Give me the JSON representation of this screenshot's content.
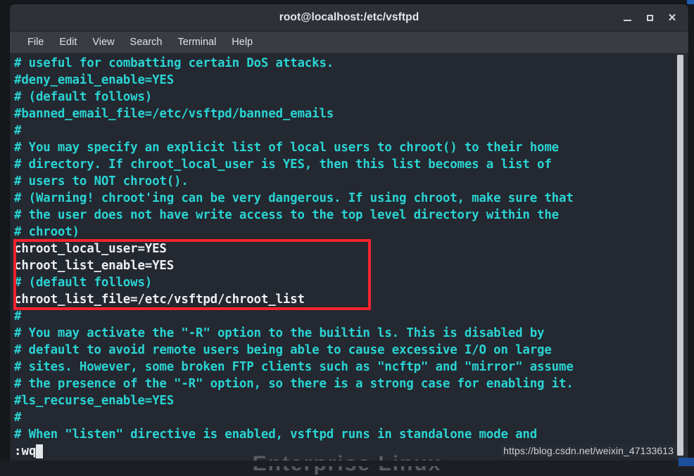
{
  "window": {
    "title": "root@localhost:/etc/vsftpd",
    "controls": [
      {
        "name": "minimize",
        "label": "_"
      },
      {
        "name": "maximize",
        "label": "□"
      },
      {
        "name": "close",
        "label": "✕"
      }
    ]
  },
  "menu": {
    "items": [
      "File",
      "Edit",
      "View",
      "Search",
      "Terminal",
      "Help"
    ]
  },
  "terminal": {
    "lines": [
      {
        "text": "# useful for combatting certain DoS attacks.",
        "kind": "comment"
      },
      {
        "text": "#deny_email_enable=YES",
        "kind": "comment"
      },
      {
        "text": "# (default follows)",
        "kind": "comment"
      },
      {
        "text": "#banned_email_file=/etc/vsftpd/banned_emails",
        "kind": "comment"
      },
      {
        "text": "#",
        "kind": "comment"
      },
      {
        "text": "# You may specify an explicit list of local users to chroot() to their home",
        "kind": "comment"
      },
      {
        "text": "# directory. If chroot_local_user is YES, then this list becomes a list of",
        "kind": "comment"
      },
      {
        "text": "# users to NOT chroot().",
        "kind": "comment"
      },
      {
        "text": "# (Warning! chroot'ing can be very dangerous. If using chroot, make sure that",
        "kind": "comment"
      },
      {
        "text": "# the user does not have write access to the top level directory within the",
        "kind": "comment"
      },
      {
        "text": "# chroot)",
        "kind": "comment"
      },
      {
        "text": "chroot_local_user=YES",
        "kind": "config"
      },
      {
        "text": "chroot_list_enable=YES",
        "kind": "config"
      },
      {
        "text": "# (default follows)",
        "kind": "comment"
      },
      {
        "text": "chroot_list_file=/etc/vsftpd/chroot_list",
        "kind": "config"
      },
      {
        "text": "#",
        "kind": "comment"
      },
      {
        "text": "# You may activate the \"-R\" option to the builtin ls. This is disabled by",
        "kind": "comment"
      },
      {
        "text": "# default to avoid remote users being able to cause excessive I/O on large",
        "kind": "comment"
      },
      {
        "text": "# sites. However, some broken FTP clients such as \"ncftp\" and \"mirror\" assume",
        "kind": "comment"
      },
      {
        "text": "# the presence of the \"-R\" option, so there is a strong case for enabling it.",
        "kind": "comment"
      },
      {
        "text": "#ls_recurse_enable=YES",
        "kind": "comment"
      },
      {
        "text": "#",
        "kind": "comment"
      },
      {
        "text": "# When \"listen\" directive is enabled, vsftpd runs in standalone mode and",
        "kind": "comment"
      }
    ],
    "status_command": ":wq",
    "highlight_color": "#f5232f",
    "comment_color": "#2ad4d4",
    "config_color": "#eceff2",
    "background_color": "#242830"
  },
  "watermark": {
    "text": "https://blog.csdn.net/weixin_47133613"
  },
  "wallpaper": {
    "text": "Enterprise Linux"
  }
}
